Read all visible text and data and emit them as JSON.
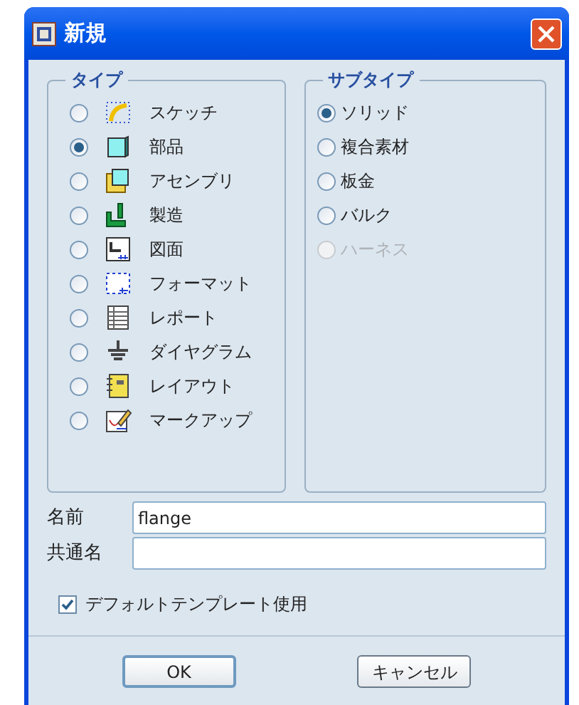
{
  "window": {
    "title": "新規"
  },
  "type_group": {
    "title": "タイプ",
    "items": [
      {
        "label": "スケッチ",
        "kind": "sketch",
        "selected": false
      },
      {
        "label": "部品",
        "kind": "part",
        "selected": true
      },
      {
        "label": "アセンブリ",
        "kind": "assembly",
        "selected": false
      },
      {
        "label": "製造",
        "kind": "manufacturing",
        "selected": false
      },
      {
        "label": "図面",
        "kind": "drawing",
        "selected": false
      },
      {
        "label": "フォーマット",
        "kind": "format",
        "selected": false
      },
      {
        "label": "レポート",
        "kind": "report",
        "selected": false
      },
      {
        "label": "ダイヤグラム",
        "kind": "diagram",
        "selected": false
      },
      {
        "label": "レイアウト",
        "kind": "layout",
        "selected": false
      },
      {
        "label": "マークアップ",
        "kind": "markup",
        "selected": false
      }
    ]
  },
  "subtype_group": {
    "title": "サブタイプ",
    "items": [
      {
        "label": "ソリッド",
        "selected": true,
        "disabled": false
      },
      {
        "label": "複合素材",
        "selected": false,
        "disabled": false
      },
      {
        "label": "板金",
        "selected": false,
        "disabled": false
      },
      {
        "label": "バルク",
        "selected": false,
        "disabled": false
      },
      {
        "label": "ハーネス",
        "selected": false,
        "disabled": true
      }
    ]
  },
  "fields": [
    {
      "label": "名前",
      "value": "flange"
    },
    {
      "label": "共通名"
    }
  ],
  "default_template": {
    "label": "デフォルトテンプレート使用",
    "checked": true
  },
  "buttons": [
    {
      "label": "OK",
      "default": true
    },
    {
      "label": "キャンセル",
      "default": false
    }
  ]
}
